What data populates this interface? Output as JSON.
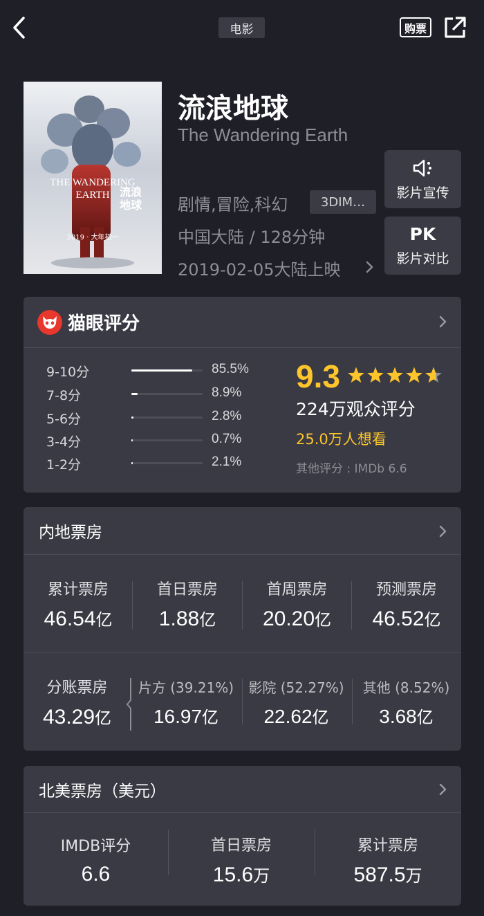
{
  "topbar": {
    "category": "电影",
    "buy_label": "购票"
  },
  "movie": {
    "title": "流浪地球",
    "subtitle": "The Wandering Earth",
    "genres": "剧情,冒险,科幻",
    "format": "3DIM…",
    "country_duration": "中国大陆 / 128分钟",
    "release": "2019-02-05大陆上映",
    "poster_title": "THE WANDERING EARTH",
    "poster_cn": "流浪地球",
    "poster_date": "2019 · 大年初一"
  },
  "side_buttons": {
    "promo_label": "影片宣传",
    "pk_icon_text": "PK",
    "pk_label": "影片对比"
  },
  "rating": {
    "header": "猫眼评分",
    "distribution": [
      {
        "label": "9-10分",
        "percent_text": "85.5%",
        "fraction": 0.855
      },
      {
        "label": "7-8分",
        "percent_text": "8.9%",
        "fraction": 0.089
      },
      {
        "label": "5-6分",
        "percent_text": "2.8%",
        "fraction": 0.028
      },
      {
        "label": "3-4分",
        "percent_text": "0.7%",
        "fraction": 0.007
      },
      {
        "label": "1-2分",
        "percent_text": "2.1%",
        "fraction": 0.021
      }
    ],
    "score": "9.3",
    "stars_filled": 4.65,
    "raters": "224万观众评分",
    "wants": "25.0万人想看",
    "other": "其他评分 : IMDb 6.6"
  },
  "domestic": {
    "header": "内地票房",
    "stats": [
      {
        "label": "累计票房",
        "value": "46.54",
        "unit": "亿"
      },
      {
        "label": "首日票房",
        "value": "1.88",
        "unit": "亿"
      },
      {
        "label": "首周票房",
        "value": "20.20",
        "unit": "亿"
      },
      {
        "label": "预测票房",
        "value": "46.52",
        "unit": "亿"
      }
    ],
    "split": {
      "label": "分账票房",
      "value": "43.29",
      "unit": "亿"
    },
    "split_parts": [
      {
        "label": "片方 (39.21%)",
        "value": "16.97",
        "unit": "亿"
      },
      {
        "label": "影院 (52.27%)",
        "value": "22.62",
        "unit": "亿"
      },
      {
        "label": "其他 (8.52%)",
        "value": "3.68",
        "unit": "亿"
      }
    ]
  },
  "north_america": {
    "header": "北美票房（美元）",
    "stats": [
      {
        "label": "IMDB评分",
        "value": "6.6",
        "unit": ""
      },
      {
        "label": "首日票房",
        "value": "15.6",
        "unit": "万"
      },
      {
        "label": "累计票房",
        "value": "587.5",
        "unit": "万"
      }
    ]
  },
  "colors": {
    "background": "#1f1f28",
    "card": "#3a3a44",
    "accent_gold": "#fdc52b",
    "maoyan_red": "#e8372d"
  }
}
